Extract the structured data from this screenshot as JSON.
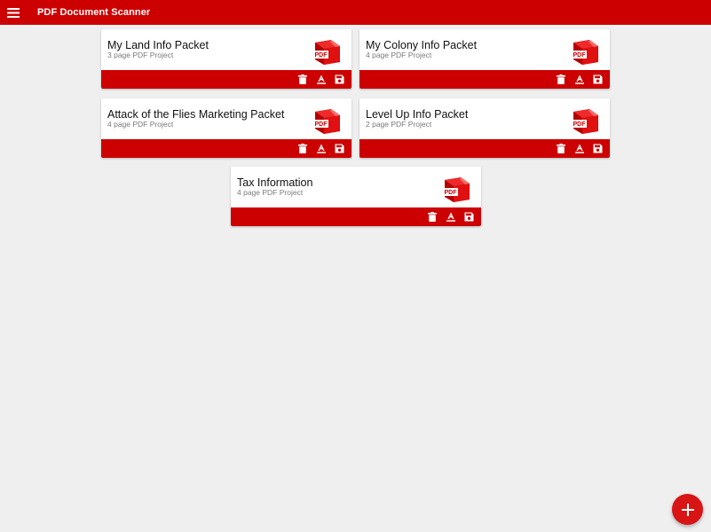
{
  "app": {
    "title": "PDF Document Scanner"
  },
  "colors": {
    "primary": "#cc0000",
    "fab": "#d81414",
    "background": "#efefef"
  },
  "icons": {
    "menu": "menu-icon",
    "thumbnail": "pdf-file-icon",
    "delete": "trash-icon",
    "rename": "rename-icon",
    "save": "save-icon",
    "add": "plus-icon"
  },
  "thumbnail_label": "PDF",
  "projects": [
    {
      "title": "My Land Info Packet",
      "subtitle": "3 page PDF Project"
    },
    {
      "title": "My Colony Info Packet",
      "subtitle": "4 page PDF Project"
    },
    {
      "title": "Attack of the Flies Marketing Packet",
      "subtitle": "4 page PDF Project"
    },
    {
      "title": "Level Up Info Packet",
      "subtitle": "2 page PDF Project"
    },
    {
      "title": "Tax Information",
      "subtitle": "4 page PDF Project"
    }
  ]
}
